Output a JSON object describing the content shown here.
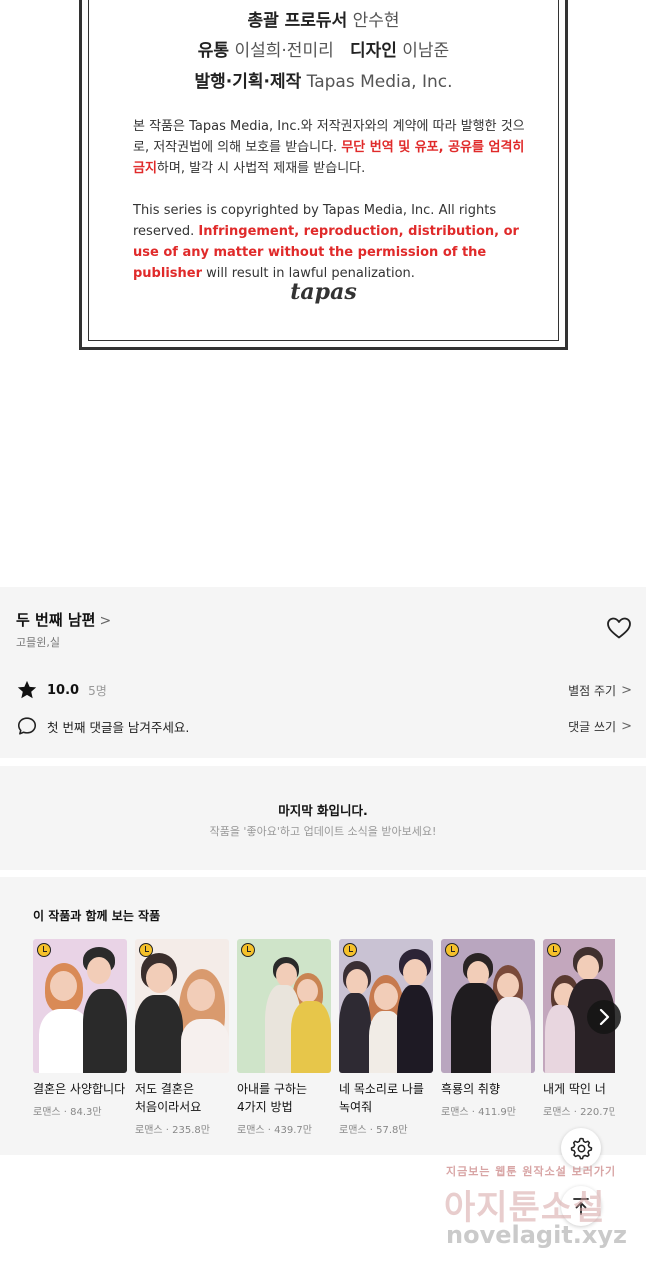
{
  "credits": {
    "lines": [
      {
        "label": "총괄 프로듀서",
        "value": "안수현"
      },
      {
        "label": "유통",
        "value": "이설희·전미리",
        "label2": "디자인",
        "value2": "이남준"
      },
      {
        "label": "발행·기획·제작",
        "value": "Tapas Media, Inc."
      }
    ],
    "notice_ko": {
      "normal1": "본 작품은 Tapas Media, Inc.와 저작권자와의 계약에 따라 발행한 것으로, 저작권법에 의해 보호를 받습니다. ",
      "red": "무단 번역 및 유포, 공유를 엄격히 금지",
      "normal2": "하며, 발각 시 사법적 제재를 받습니다."
    },
    "notice_en": {
      "normal1": "This series is copyrighted by Tapas Media, Inc. All rights reserved. ",
      "red": "Infringement, reproduction, distribution, or use of any matter without the permission of the publisher",
      "normal2": " will result in lawful penalization."
    },
    "logo": "tapas"
  },
  "series": {
    "title": "두 번째 남편",
    "authors": "고믈윈,실",
    "rating": "10.0",
    "rating_count": "5명",
    "rate_link": "별점 주기",
    "comment_prompt": "첫 번째 댓글을 남겨주세요.",
    "comment_link": "댓글 쓰기"
  },
  "last_episode": {
    "title": "마지막 화입니다.",
    "subtitle": "작품을 '좋아요'하고 업데이트 소식을 받아보세요!"
  },
  "recommendations": {
    "heading": "이 작품과 함께 보는 작품",
    "items": [
      {
        "title": "결혼은 사양합니다",
        "meta": "로맨스 · 84.3만",
        "bg": "#e9d3e6",
        "hair": "#d98a56",
        "body": "#ffffff"
      },
      {
        "title": "저도 결혼은 처음이라서요",
        "meta": "로맨스 · 235.8만",
        "bg": "#f4ece8",
        "hair": "#3a2e2c",
        "body": "#2a2a2a"
      },
      {
        "title": "아내를 구하는 4가지 방법",
        "meta": "로맨스 · 439.7만",
        "bg": "#cfe4c9",
        "hair": "#2a2a2a",
        "body": "#e7c64a"
      },
      {
        "title": "네 목소리로 나를 녹여줘",
        "meta": "로맨스 · 57.8만",
        "bg": "#c9c2d3",
        "hair": "#2c2436",
        "body": "#1e1a24"
      },
      {
        "title": "흑룡의 취향",
        "meta": "로맨스 · 411.9만",
        "bg": "#b9a6bf",
        "hair": "#2a2424",
        "body": "#1f1c1f"
      },
      {
        "title": "내게 딱인 너",
        "meta": "로맨스 · 220.7만",
        "bg": "#c3a7bd",
        "hair": "#40302e",
        "body": "#2a2226"
      }
    ]
  },
  "icons": {
    "heart": "heart-icon",
    "star": "star-icon",
    "comment": "comment-icon",
    "settings": "gear-icon",
    "top": "arrow-up-icon",
    "next": "chevron-right-icon"
  },
  "watermark": {
    "small": "지금보는 웹툰 원작소설 보러가기",
    "big": "아지툰소설",
    "url": "novelagit.xyz"
  }
}
